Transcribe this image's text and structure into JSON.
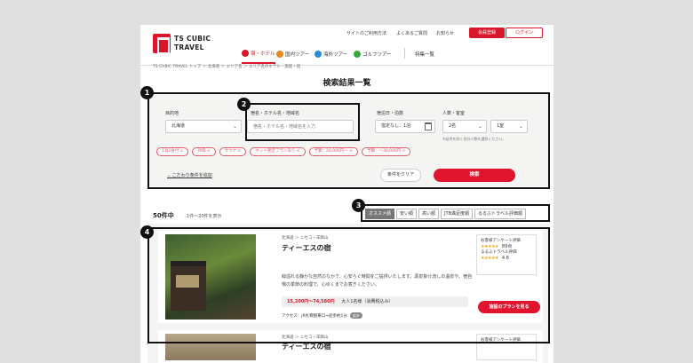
{
  "header": {
    "logo_line1": "TS CUBIC",
    "logo_line2": "TRAVEL",
    "util_links": [
      "サイトのご利用方法",
      "よくあるご質問",
      "お知らせ"
    ],
    "member_button": "会員登録",
    "login_button": "ログイン",
    "nav": [
      "宿・ホテル",
      "国内ツアー",
      "海外ツアー",
      "ゴルフツアー",
      "特集一覧"
    ]
  },
  "breadcrumb": "TS CUBIC TRAVEL トップ ＞ 北海道 ＞ エリア名 ＞ エリア名のホテル・旅館・宿",
  "page_title": "検索結果一覧",
  "search": {
    "destination_label": "目的地",
    "destination_value": "北海道",
    "keyword_label": "宿名・ホテル名・地域名",
    "keyword_placeholder": "宿名・ホテル名・地域名を入力",
    "date_label": "宿泊日・泊数",
    "date_value": "指定なし：1泊",
    "guests_label": "人数・客室",
    "guests_value": "2名",
    "rooms_value": "1室",
    "guests_note": "※幼児を除く合計人数を選択ください。",
    "chips": [
      "1泊2食付 ×",
      "評価 ×",
      "サウナ ×",
      "ネット限定プランあり ×",
      "予算：20,000円〜 ×",
      "予算：〜30,000円 ×"
    ],
    "more_conditions": "こだわり条件を追加",
    "clear_button": "条件をクリア",
    "search_button": "検索"
  },
  "results": {
    "count_number": "50件中",
    "range": "1件〜20件を表示",
    "sort_tabs": [
      "オススメ順",
      "安い順",
      "高い順",
      "JTB満足度順",
      "るるぶトラベル評価順"
    ],
    "active_sort": "オススメ順"
  },
  "cards": [
    {
      "region": "北海道 ＞ ニセコ・羊蹄山",
      "name": "ティーエスの宿",
      "description": "緑溢れる静かな自然のなかで、心安らぐ時間をご提供いたします。源泉掛け流しの温泉や、宿自慢の季節の料理で、心ゆくまでお寛ぎください。",
      "price": "15,200円〜74,580円",
      "price_note": "大人1名様（消費税込み）",
      "access": "アクセス：JR札幌駅東口⇒徒歩約1分",
      "walk_badge": "徒歩",
      "review_title": "お客様アンケート評価",
      "review_stars": "★★★★★",
      "review_score": "89点",
      "rurubu_title": "るるぶトラベル評価",
      "rurubu_stars": "★★★★★",
      "rurubu_score": "4.6",
      "plan_button": "施設のプランを見る"
    },
    {
      "region": "北海道 ＞ ニセコ・羊蹄山",
      "name": "ティーエスの宿",
      "review_title": "お客様アンケート評価"
    }
  ],
  "annotations": [
    "1",
    "2",
    "3",
    "4"
  ]
}
